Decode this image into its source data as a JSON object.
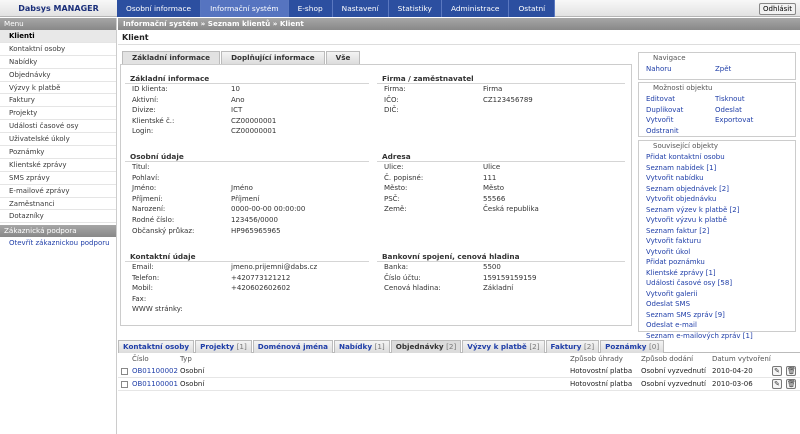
{
  "app": {
    "brand": "Dabsys MANAGER",
    "logout": "Odhlásit"
  },
  "topnav": [
    "Osobní informace",
    "Informační systém",
    "E-shop",
    "Nastavení",
    "Statistiky",
    "Administrace",
    "Ostatní"
  ],
  "sidebar": {
    "menu_title": "Menu",
    "items": [
      "Klienti",
      "Kontaktní osoby",
      "Nabídky",
      "Objednávky",
      "Výzvy k platbě",
      "Faktury",
      "Projekty",
      "Události časové osy",
      "Uživatelské úkoly",
      "Poznámky",
      "Klientské zprávy",
      "SMS zprávy",
      "E-mailové zprávy",
      "Zaměstnanci",
      "Dotazníky"
    ],
    "support_title": "Zákaznická podpora",
    "support_link": "Otevřít zákaznickou podporu"
  },
  "breadcrumb": "Informační systém » Seznam klientů » Klient",
  "page_title": "Klient",
  "content_tabs": [
    "Základní informace",
    "Doplňující informace",
    "Vše"
  ],
  "basic": {
    "title": "Základní informace",
    "rows": [
      {
        "label": "ID klienta:",
        "value": "10"
      },
      {
        "label": "Aktivní:",
        "value": "Ano"
      },
      {
        "label": "Divize:",
        "value": "ICT"
      },
      {
        "label": "Klientské č.:",
        "value": "CZ00000001"
      },
      {
        "label": "Login:",
        "value": "CZ00000001"
      }
    ]
  },
  "company": {
    "title": "Firma / zaměstnavatel",
    "rows": [
      {
        "label": "Firma:",
        "value": "Firma"
      },
      {
        "label": "IČO:",
        "value": "CZ123456789"
      },
      {
        "label": "DIČ:",
        "value": ""
      }
    ]
  },
  "personal": {
    "title": "Osobní údaje",
    "rows": [
      {
        "label": "Titul:",
        "value": ""
      },
      {
        "label": "Pohlaví:",
        "value": ""
      },
      {
        "label": "Jméno:",
        "value": "Jméno"
      },
      {
        "label": "Příjmení:",
        "value": "Příjmení"
      },
      {
        "label": "Narození:",
        "value": "0000-00-00 00:00:00"
      },
      {
        "label": "Rodné číslo:",
        "value": "123456/0000"
      },
      {
        "label": "Občanský průkaz:",
        "value": "HP965965965"
      }
    ]
  },
  "address": {
    "title": "Adresa",
    "rows": [
      {
        "label": "Ulice:",
        "value": "Ulice"
      },
      {
        "label": "Č. popisné:",
        "value": "111"
      },
      {
        "label": "Město:",
        "value": "Město"
      },
      {
        "label": "PSČ:",
        "value": "55566"
      },
      {
        "label": "Země:",
        "value": "Česká republika"
      }
    ]
  },
  "contact": {
    "title": "Kontaktní údaje",
    "rows": [
      {
        "label": "Email:",
        "value": "jmeno.prijemni@dabs.cz"
      },
      {
        "label": "Telefon:",
        "value": "+420773121212"
      },
      {
        "label": "Mobil:",
        "value": "+420602602602"
      },
      {
        "label": "Fax:",
        "value": ""
      },
      {
        "label": "WWW stránky:",
        "value": ""
      }
    ]
  },
  "bank": {
    "title": "Bankovní spojení, cenová hladina",
    "rows": [
      {
        "label": "Banka:",
        "value": "5500"
      },
      {
        "label": "Číslo účtu:",
        "value": "159159159159"
      },
      {
        "label": "Cenová hladina:",
        "value": "Základní"
      }
    ]
  },
  "navigation": {
    "title": "Navigace",
    "links": [
      "Nahoru",
      "Zpět"
    ]
  },
  "options": {
    "title": "Možnosti objektu",
    "links": [
      "Editovat",
      "Tisknout",
      "Duplikovat",
      "Odeslat",
      "Vytvořit",
      "Exportovat",
      "Odstranit"
    ]
  },
  "related": {
    "title": "Související objekty",
    "links": [
      "Přidat kontaktní osobu",
      "Seznam nabídek [1]",
      "Vytvořit nabídku",
      "Seznam objednávek [2]",
      "Vytvořit objednávku",
      "Seznam výzev k platbě [2]",
      "Vytvořit výzvu k platbě",
      "Seznam faktur [2]",
      "Vytvořit fakturu",
      "Vytvořit úkol",
      "Přidat poznámku",
      "Klientské zprávy [1]",
      "Události časové osy [58]",
      "Vytvořit galerii",
      "Odeslat SMS",
      "Seznam SMS zpráv [9]",
      "Odeslat e-mail",
      "Seznam e-mailových zpráv [1]"
    ]
  },
  "bottom_tabs": [
    {
      "label": "Kontaktní osoby",
      "count": ""
    },
    {
      "label": "Projekty",
      "count": "[1]"
    },
    {
      "label": "Doménová jména",
      "count": ""
    },
    {
      "label": "Nabídky",
      "count": "[1]"
    },
    {
      "label": "Objednávky",
      "count": "[2]"
    },
    {
      "label": "Výzvy k platbě",
      "count": "[2]"
    },
    {
      "label": "Faktury",
      "count": "[2]"
    },
    {
      "label": "Poznámky",
      "count": "[0]"
    }
  ],
  "table": {
    "headers": [
      "Číslo",
      "Typ",
      "Způsob úhrady",
      "Způsob dodání",
      "Datum vytvoření"
    ],
    "rows": [
      {
        "cislo": "OB01100002",
        "typ": "Osobní",
        "uhrada": "Hotovostní platba",
        "dodani": "Osobní vyzvednutí",
        "datum": "2010-04-20"
      },
      {
        "cislo": "OB01100001",
        "typ": "Osobní",
        "uhrada": "Hotovostní platba",
        "dodani": "Osobní vyzvednutí",
        "datum": "2010-03-06"
      }
    ]
  }
}
